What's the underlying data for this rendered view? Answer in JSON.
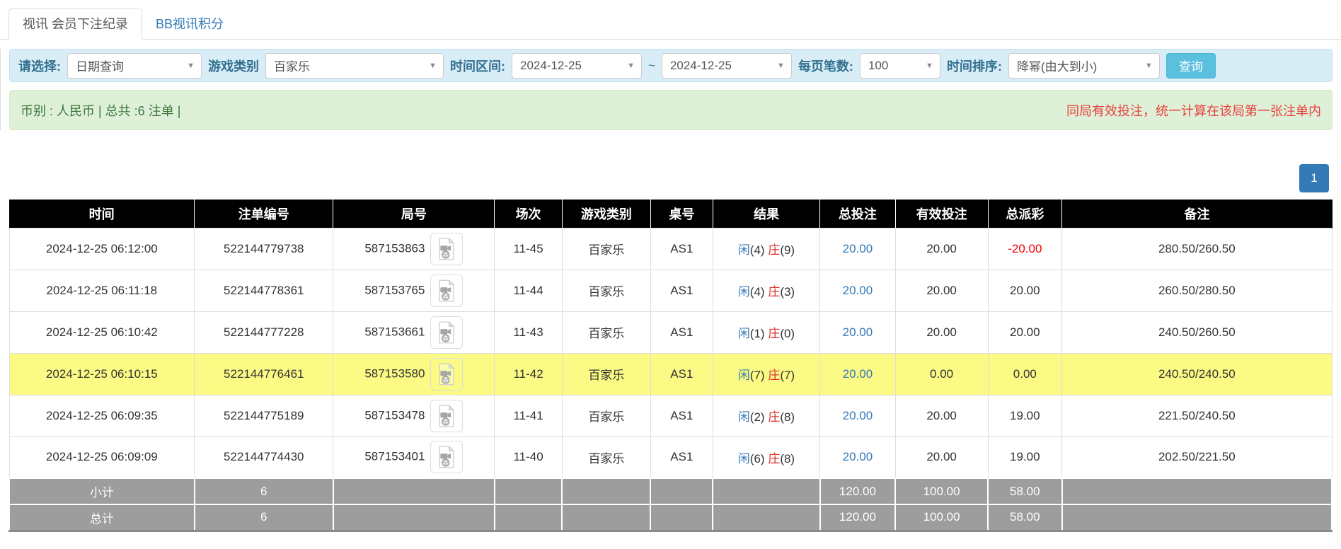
{
  "tabs": [
    {
      "label": "视讯 会员下注纪录",
      "active": true
    },
    {
      "label": "BB视讯积分",
      "active": false
    }
  ],
  "filters": {
    "select_label": "请选择:",
    "select_value": "日期查询",
    "game_type_label": "游戏类别",
    "game_type_value": "百家乐",
    "time_range_label": "时间区间:",
    "date_from": "2024-12-25",
    "tilde": "~",
    "date_to": "2024-12-25",
    "page_size_label": "每页笔数:",
    "page_size_value": "100",
    "sort_label": "时间排序:",
    "sort_value": "降幂(由大到小)",
    "search_button": "查询"
  },
  "info_bar": {
    "summary": "币别 : 人民币 | 总共 :6 注单 |",
    "notice": "同局有效投注，统一计算在该局第一张注单内"
  },
  "pagination": {
    "current_page": "1"
  },
  "table": {
    "headers": [
      "时间",
      "注单编号",
      "局号",
      "场次",
      "游戏类别",
      "桌号",
      "结果",
      "总投注",
      "有效投注",
      "总派彩",
      "备注"
    ],
    "rows": [
      {
        "time": "2024-12-25 06:12:00",
        "bet_id": "522144779738",
        "round_id": "587153863",
        "session": "11-45",
        "game": "百家乐",
        "table_no": "AS1",
        "xian": "闲",
        "xian_val": "(4)",
        "zhuang": "庄",
        "zhuang_val": "(9)",
        "total_bet": "20.00",
        "valid_bet": "20.00",
        "payout": "-20.00",
        "remark": "280.50/260.50",
        "highlight": false
      },
      {
        "time": "2024-12-25 06:11:18",
        "bet_id": "522144778361",
        "round_id": "587153765",
        "session": "11-44",
        "game": "百家乐",
        "table_no": "AS1",
        "xian": "闲",
        "xian_val": "(4)",
        "zhuang": "庄",
        "zhuang_val": "(3)",
        "total_bet": "20.00",
        "valid_bet": "20.00",
        "payout": "20.00",
        "remark": "260.50/280.50",
        "highlight": false
      },
      {
        "time": "2024-12-25 06:10:42",
        "bet_id": "522144777228",
        "round_id": "587153661",
        "session": "11-43",
        "game": "百家乐",
        "table_no": "AS1",
        "xian": "闲",
        "xian_val": "(1)",
        "zhuang": "庄",
        "zhuang_val": "(0)",
        "total_bet": "20.00",
        "valid_bet": "20.00",
        "payout": "20.00",
        "remark": "240.50/260.50",
        "highlight": false
      },
      {
        "time": "2024-12-25 06:10:15",
        "bet_id": "522144776461",
        "round_id": "587153580",
        "session": "11-42",
        "game": "百家乐",
        "table_no": "AS1",
        "xian": "闲",
        "xian_val": "(7)",
        "zhuang": "庄",
        "zhuang_val": "(7)",
        "total_bet": "20.00",
        "valid_bet": "0.00",
        "payout": "0.00",
        "remark": "240.50/240.50",
        "highlight": true
      },
      {
        "time": "2024-12-25 06:09:35",
        "bet_id": "522144775189",
        "round_id": "587153478",
        "session": "11-41",
        "game": "百家乐",
        "table_no": "AS1",
        "xian": "闲",
        "xian_val": "(2)",
        "zhuang": "庄",
        "zhuang_val": "(8)",
        "total_bet": "20.00",
        "valid_bet": "20.00",
        "payout": "19.00",
        "remark": "221.50/240.50",
        "highlight": false
      },
      {
        "time": "2024-12-25 06:09:09",
        "bet_id": "522144774430",
        "round_id": "587153401",
        "session": "11-40",
        "game": "百家乐",
        "table_no": "AS1",
        "xian": "闲",
        "xian_val": "(6)",
        "zhuang": "庄",
        "zhuang_val": "(8)",
        "total_bet": "20.00",
        "valid_bet": "20.00",
        "payout": "19.00",
        "remark": "202.50/221.50",
        "highlight": false
      }
    ],
    "footer": [
      {
        "label": "小计",
        "count": "6",
        "total_bet": "120.00",
        "valid_bet": "100.00",
        "payout": "58.00"
      },
      {
        "label": "总计",
        "count": "6",
        "total_bet": "120.00",
        "valid_bet": "100.00",
        "payout": "58.00"
      }
    ]
  },
  "colors": {
    "link_blue": "#337ab7",
    "search_button_blue": "#5bc0de",
    "filter_panel_bg": "#d9edf7",
    "filter_label": "#31708f",
    "info_bar_bg": "#dff0d8",
    "info_text_green": "#3c763d",
    "notice_red": "#e8413c",
    "header_bg": "#000000",
    "footer_bg": "#9d9d9d",
    "highlight_yellow": "#fafa85",
    "player_blue": "#337ab7",
    "banker_red": "#d9302c",
    "negative_red": "#f20000"
  }
}
